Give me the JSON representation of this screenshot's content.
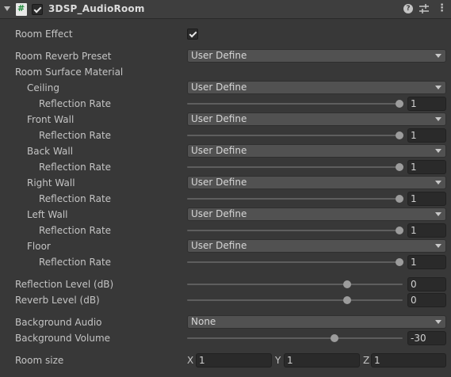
{
  "header": {
    "title": "3DSP_AudioRoom",
    "enabled": true
  },
  "room_effect": {
    "label": "Room Effect",
    "checked": true
  },
  "room_reverb_preset": {
    "label": "Room Reverb Preset",
    "value": "User Define"
  },
  "surface_material_label": "Room Surface Material",
  "surfaces": [
    {
      "label": "Ceiling",
      "material": "User Define",
      "rate_label": "Reflection Rate",
      "rate": "1"
    },
    {
      "label": "Front Wall",
      "material": "User Define",
      "rate_label": "Reflection Rate",
      "rate": "1"
    },
    {
      "label": "Back Wall",
      "material": "User Define",
      "rate_label": "Reflection Rate",
      "rate": "1"
    },
    {
      "label": "Right Wall",
      "material": "User Define",
      "rate_label": "Reflection Rate",
      "rate": "1"
    },
    {
      "label": "Left Wall",
      "material": "User Define",
      "rate_label": "Reflection Rate",
      "rate": "1"
    },
    {
      "label": "Floor",
      "material": "User Define",
      "rate_label": "Reflection Rate",
      "rate": "1"
    }
  ],
  "reflection_level": {
    "label": "Reflection Level (dB)",
    "value": "0"
  },
  "reverb_level": {
    "label": "Reverb Level (dB)",
    "value": "0"
  },
  "background_audio": {
    "label": "Background Audio",
    "value": "None"
  },
  "background_volume": {
    "label": "Background Volume",
    "value": "-30"
  },
  "room_size": {
    "label": "Room size",
    "x_label": "X",
    "x": "1",
    "y_label": "Y",
    "y": "1",
    "z_label": "Z",
    "z": "1"
  }
}
